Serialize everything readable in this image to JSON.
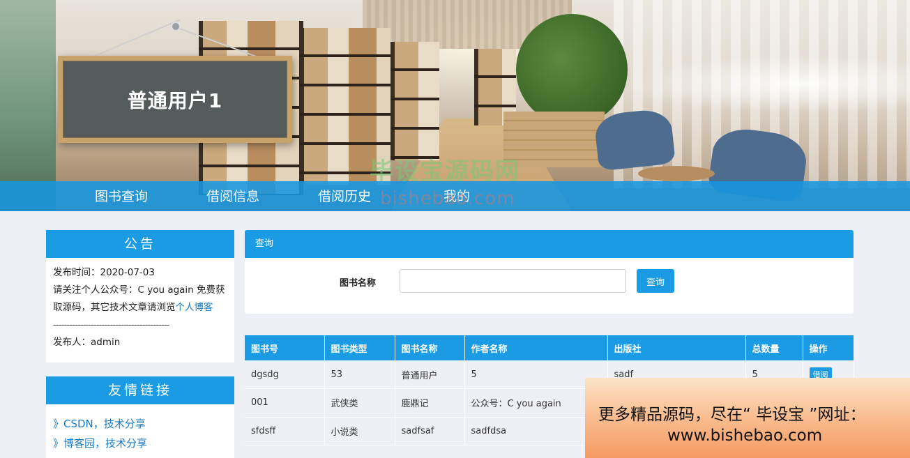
{
  "banner": {
    "sign_title": "普通用户1",
    "watermark_cn": "毕设宝源码网",
    "watermark_en": "bishebao.com"
  },
  "nav": {
    "items": [
      {
        "label": "图书查询"
      },
      {
        "label": "借阅信息"
      },
      {
        "label": "借阅历史"
      },
      {
        "label": "我的"
      }
    ]
  },
  "notice": {
    "title": "公告",
    "publish_time": "发布时间：2020-07-03",
    "content_prefix": "请关注个人公众号：C you again 免费获取源码，其它技术文章请浏览",
    "content_link": "个人博客",
    "divider": "-------------------------------------------",
    "publisher": "发布人：admin"
  },
  "friend_links": {
    "title": "友情链接",
    "items": [
      {
        "label": "》CSDN，技术分享"
      },
      {
        "label": "》博客园，技术分享"
      }
    ]
  },
  "query": {
    "header": "查询",
    "field_label": "图书名称",
    "field_value": "",
    "field_placeholder": "",
    "button_label": "查询"
  },
  "table": {
    "columns": [
      "图书号",
      "图书类型",
      "图书名称",
      "作者名称",
      "出版社",
      "总数量",
      "操作"
    ],
    "rows": [
      {
        "id": "dgsdg",
        "type": "53",
        "name": "普通用户",
        "author": "5",
        "publisher": "sadf",
        "total": "5",
        "action": "借阅"
      },
      {
        "id": "001",
        "type": "武侠类",
        "name": "鹿鼎记",
        "author": "公众号：C you again",
        "publisher": "",
        "total": "",
        "action": ""
      },
      {
        "id": "sfdsff",
        "type": "小说类",
        "name": "sadfsaf",
        "author": "sadfdsa",
        "publisher": "",
        "total": "",
        "action": ""
      }
    ]
  },
  "ad": {
    "line1": "更多精品源码，尽在“ 毕设宝 ”网址：",
    "line2": "www.bishebao.com"
  }
}
